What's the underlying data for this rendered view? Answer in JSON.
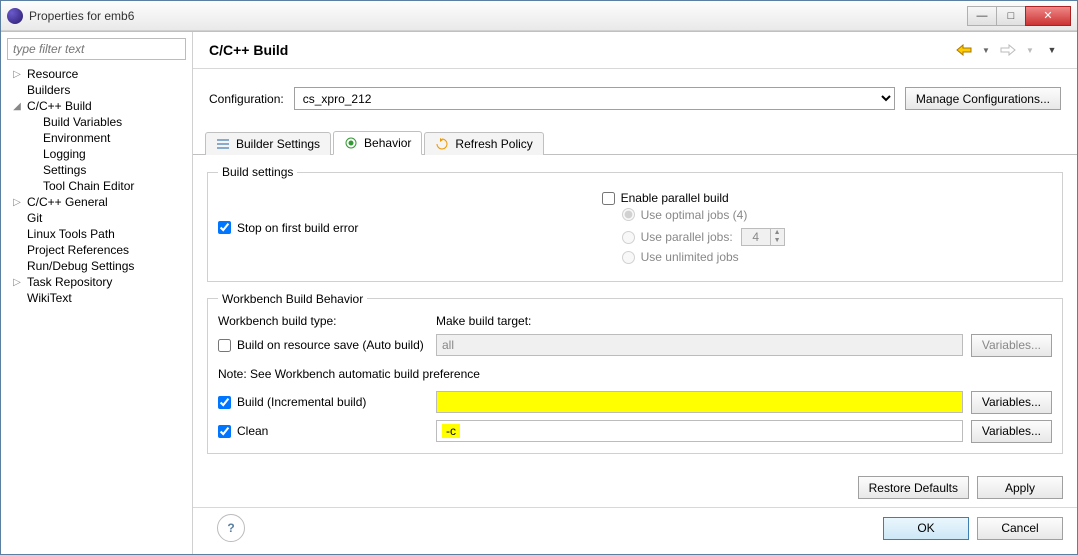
{
  "window": {
    "title": "Properties for emb6"
  },
  "filter_placeholder": "type filter text",
  "tree": {
    "items": [
      {
        "label": "Resource",
        "level": 0,
        "twist": "▷"
      },
      {
        "label": "Builders",
        "level": 0,
        "twist": ""
      },
      {
        "label": "C/C++ Build",
        "level": 0,
        "twist": "◢"
      },
      {
        "label": "Build Variables",
        "level": 1,
        "twist": ""
      },
      {
        "label": "Environment",
        "level": 1,
        "twist": ""
      },
      {
        "label": "Logging",
        "level": 1,
        "twist": ""
      },
      {
        "label": "Settings",
        "level": 1,
        "twist": ""
      },
      {
        "label": "Tool Chain Editor",
        "level": 1,
        "twist": ""
      },
      {
        "label": "C/C++ General",
        "level": 0,
        "twist": "▷"
      },
      {
        "label": "Git",
        "level": 0,
        "twist": ""
      },
      {
        "label": "Linux Tools Path",
        "level": 0,
        "twist": ""
      },
      {
        "label": "Project References",
        "level": 0,
        "twist": ""
      },
      {
        "label": "Run/Debug Settings",
        "level": 0,
        "twist": ""
      },
      {
        "label": "Task Repository",
        "level": 0,
        "twist": "▷"
      },
      {
        "label": "WikiText",
        "level": 0,
        "twist": ""
      }
    ]
  },
  "header": {
    "title": "C/C++ Build"
  },
  "config": {
    "label": "Configuration:",
    "value": "cs_xpro_212",
    "manage_btn": "Manage Configurations..."
  },
  "tabs": {
    "builder": "Builder Settings",
    "behavior": "Behavior",
    "refresh": "Refresh Policy"
  },
  "build_settings": {
    "legend": "Build settings",
    "stop_first_error": "Stop on first build error",
    "enable_parallel": "Enable parallel build",
    "optimal_jobs": "Use optimal jobs (4)",
    "parallel_jobs_label": "Use parallel jobs:",
    "parallel_jobs_value": "4",
    "unlimited_jobs": "Use unlimited jobs"
  },
  "workbench": {
    "legend": "Workbench Build Behavior",
    "type_header": "Workbench build type:",
    "target_header": "Make build target:",
    "auto_build_label": "Build on resource save (Auto build)",
    "auto_build_target": "all",
    "note": "Note: See Workbench automatic build preference",
    "incremental_label": "Build (Incremental build)",
    "incremental_target": "",
    "clean_label": "Clean",
    "clean_target": "-c",
    "variables_btn": "Variables..."
  },
  "buttons": {
    "restore": "Restore Defaults",
    "apply": "Apply",
    "ok": "OK",
    "cancel": "Cancel"
  }
}
